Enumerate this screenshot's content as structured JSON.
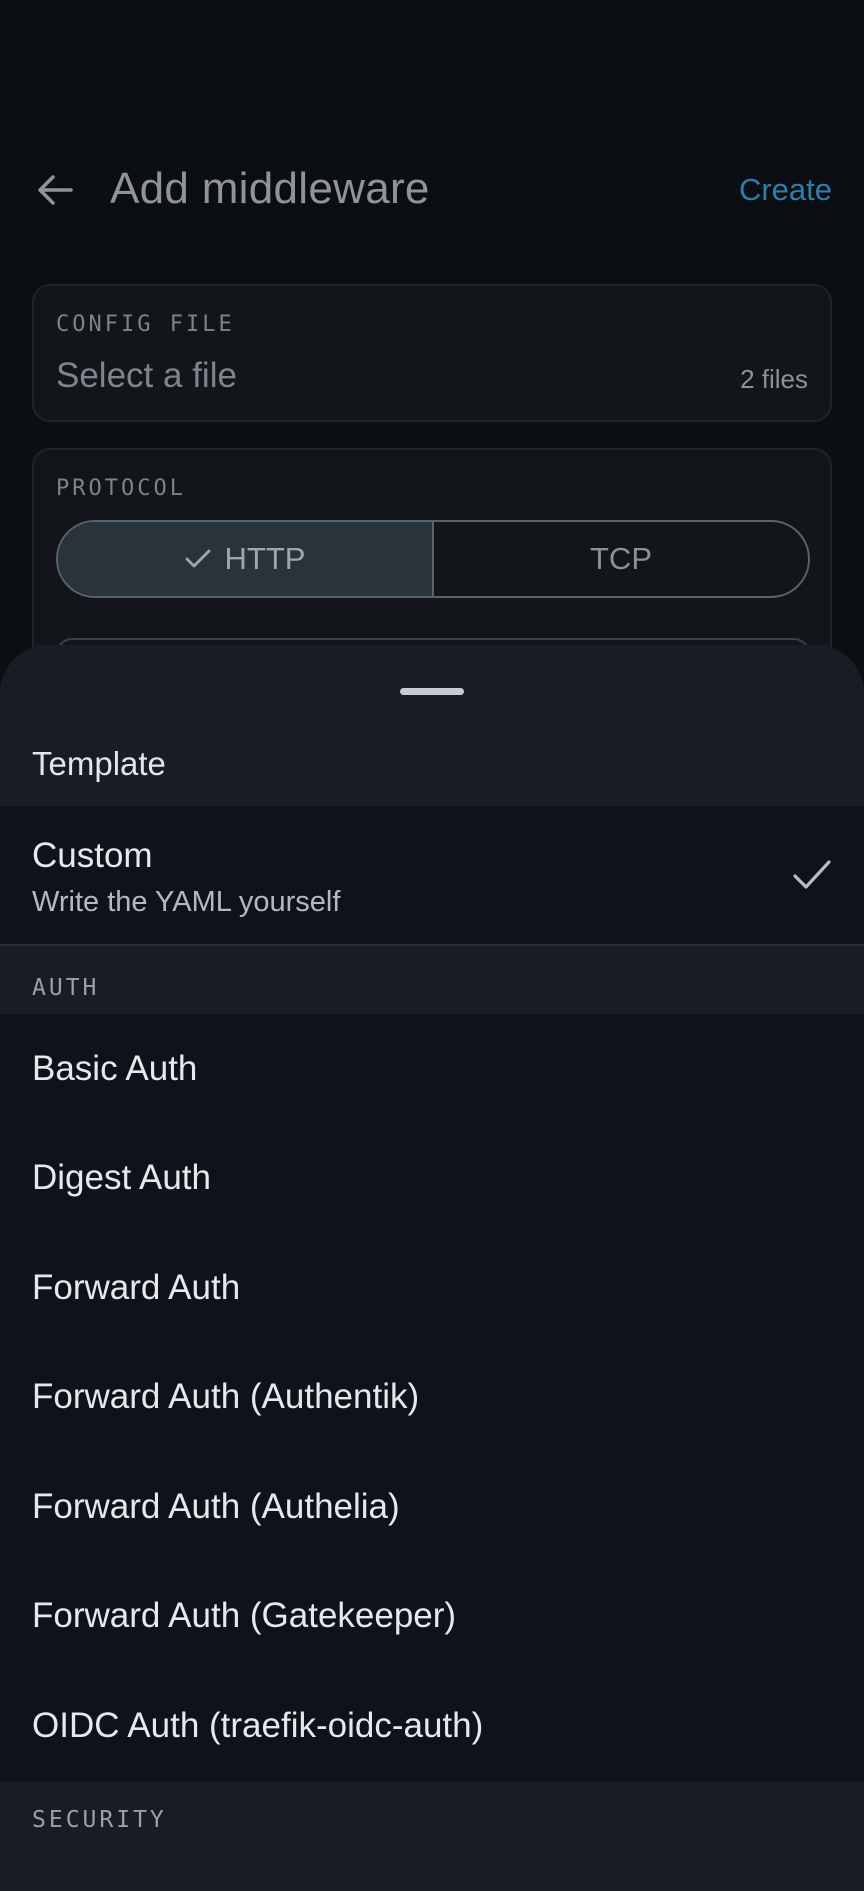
{
  "header": {
    "title": "Add middleware",
    "create_label": "Create"
  },
  "config_file": {
    "label": "CONFIG FILE",
    "placeholder": "Select a file",
    "count": "2 files"
  },
  "protocol": {
    "label": "PROTOCOL",
    "options": [
      "HTTP",
      "TCP"
    ],
    "selected": "HTTP"
  },
  "sheet": {
    "title": "Template",
    "custom": {
      "title": "Custom",
      "subtitle": "Write the YAML yourself",
      "selected": true
    },
    "sections": [
      {
        "label": "AUTH",
        "items": [
          "Basic Auth",
          "Digest Auth",
          "Forward Auth",
          "Forward Auth (Authentik)",
          "Forward Auth (Authelia)",
          "Forward Auth (Gatekeeper)",
          "OIDC Auth (traefik-oidc-auth)"
        ]
      },
      {
        "label": "SECURITY",
        "items": []
      }
    ]
  },
  "colors": {
    "background": "#0b0e13",
    "accent": "#2f7ea9",
    "sheet": "#181c24",
    "list": "#0f121a"
  }
}
